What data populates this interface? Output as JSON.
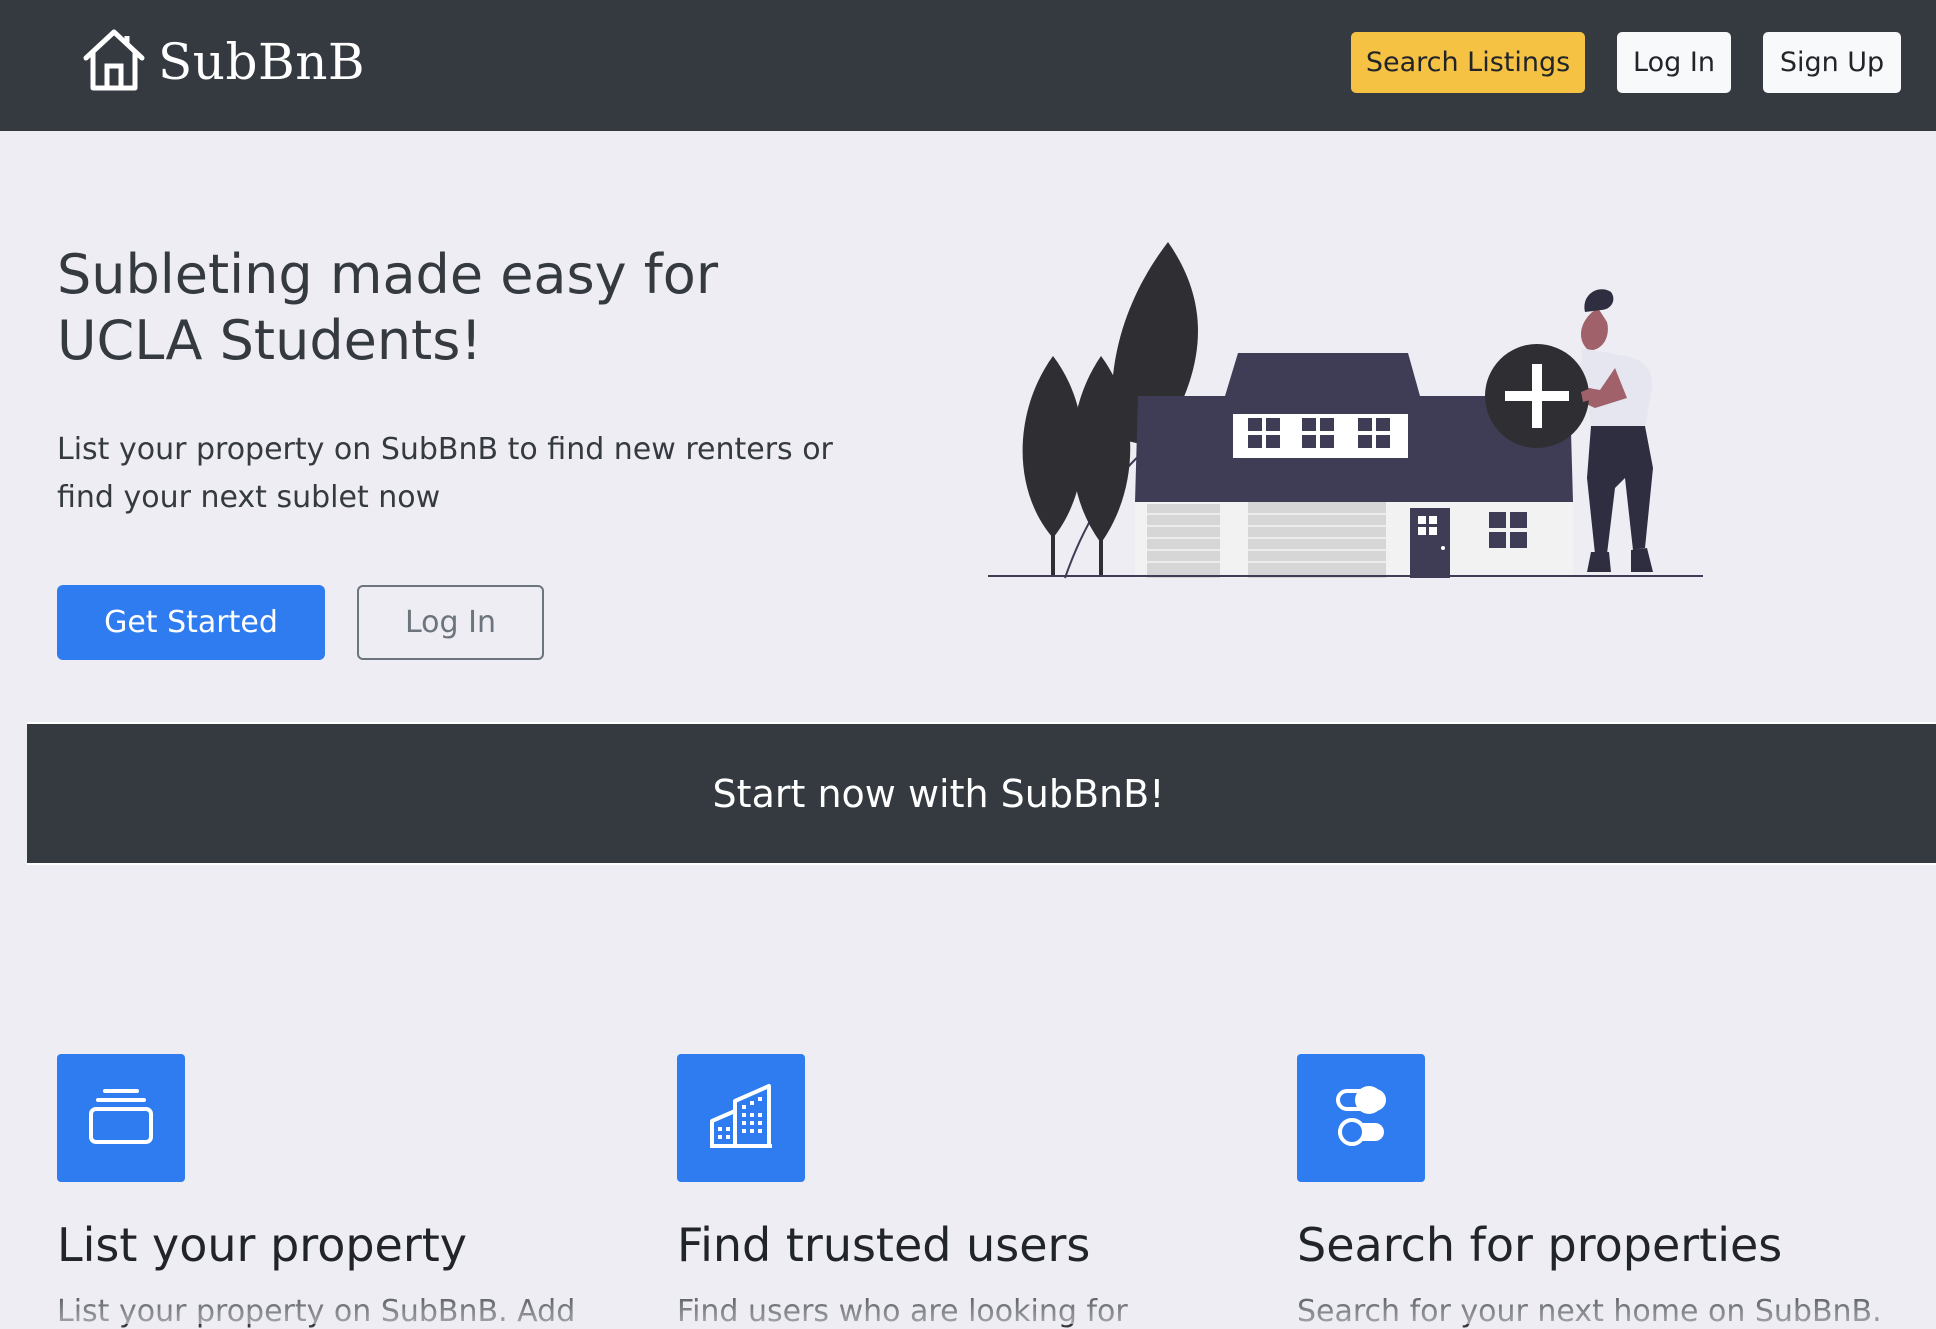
{
  "navbar": {
    "brand": "SubBnB",
    "search_label": "Search Listings",
    "login_label": "Log In",
    "signup_label": "Sign Up"
  },
  "hero": {
    "title_line1": "Subleting made easy for",
    "title_line2": "UCLA Students!",
    "subtitle_line1": "List your property on SubBnB to find new renters or",
    "subtitle_line2": "find your next sublet now",
    "get_started_label": "Get Started",
    "login_label": "Log In"
  },
  "banner": {
    "text": "Start now with SubBnB!"
  },
  "features": [
    {
      "icon": "collection-icon",
      "title": "List your property",
      "text": "List your property on SubBnB. Add"
    },
    {
      "icon": "buildings-icon",
      "title": "Find trusted users",
      "text": "Find users who are looking for"
    },
    {
      "icon": "toggles-icon",
      "title": "Search for properties",
      "text": "Search for your next home on SubBnB."
    }
  ],
  "colors": {
    "navbar_bg": "#343a40",
    "accent_yellow": "#f6c244",
    "primary_blue": "#2f7cf0",
    "page_bg": "#eeedf3"
  }
}
